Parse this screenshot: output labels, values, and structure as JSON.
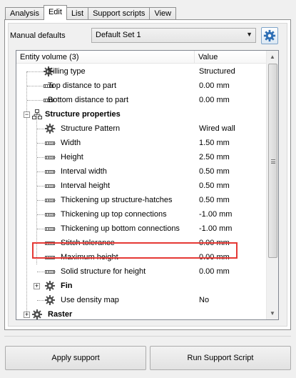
{
  "tabs": [
    {
      "label": "Analysis",
      "active": false
    },
    {
      "label": "Edit",
      "active": true
    },
    {
      "label": "List",
      "active": false
    },
    {
      "label": "Support scripts",
      "active": false
    },
    {
      "label": "View",
      "active": false
    }
  ],
  "defaults": {
    "label": "Manual defaults",
    "selected": "Default Set 1",
    "settings_icon": "gear-icon"
  },
  "grid": {
    "header": {
      "entity": "Entity volume (3)",
      "value": "Value"
    },
    "highlight_color": "#e53935",
    "rows": [
      {
        "label": "Filling type",
        "value": "Structured",
        "icon": "gear-icon",
        "level": 1
      },
      {
        "label": "Top distance to part",
        "value": "0.00 mm",
        "icon": "ruler-icon",
        "level": 1
      },
      {
        "label": "Bottom distance to part",
        "value": "0.00 mm",
        "icon": "ruler-icon",
        "level": 1
      },
      {
        "label": "Structure properties",
        "value": "",
        "icon": "structure-icon",
        "level": 0,
        "bold": true,
        "expanded": true
      },
      {
        "label": "Structure Pattern",
        "value": "Wired wall",
        "icon": "gear-icon",
        "level": 2
      },
      {
        "label": "Width",
        "value": "1.50 mm",
        "icon": "ruler-icon",
        "level": 2
      },
      {
        "label": "Height",
        "value": "2.50 mm",
        "icon": "ruler-icon",
        "level": 2
      },
      {
        "label": "Interval width",
        "value": "0.50 mm",
        "icon": "ruler-icon",
        "level": 2
      },
      {
        "label": "Interval height",
        "value": "0.50 mm",
        "icon": "ruler-icon",
        "level": 2
      },
      {
        "label": "Thickening up structure-hatches",
        "value": "0.50 mm",
        "icon": "ruler-icon",
        "level": 2,
        "highlighted": true
      },
      {
        "label": "Thickening up top connections",
        "value": "-1.00 mm",
        "icon": "ruler-icon",
        "level": 2
      },
      {
        "label": "Thickening up bottom connections",
        "value": "-1.00 mm",
        "icon": "ruler-icon",
        "level": 2
      },
      {
        "label": "Stitch tolerance",
        "value": "0.00 mm",
        "icon": "ruler-icon",
        "level": 2
      },
      {
        "label": "Maximum height",
        "value": "0.00 mm",
        "icon": "ruler-icon",
        "level": 2
      },
      {
        "label": "Solid structure for height",
        "value": "0.00 mm",
        "icon": "ruler-icon",
        "level": 2
      },
      {
        "label": "Fin",
        "value": "",
        "icon": "gear-icon",
        "level": 1,
        "bold": true,
        "expanded": false
      },
      {
        "label": "Use density map",
        "value": "No",
        "icon": "gear-icon",
        "level": 1
      },
      {
        "label": "Raster",
        "value": "",
        "icon": "gear-icon",
        "level": 0,
        "bold": true,
        "expanded": false
      }
    ]
  },
  "buttons": {
    "apply": "Apply support",
    "run": "Run Support Script"
  }
}
